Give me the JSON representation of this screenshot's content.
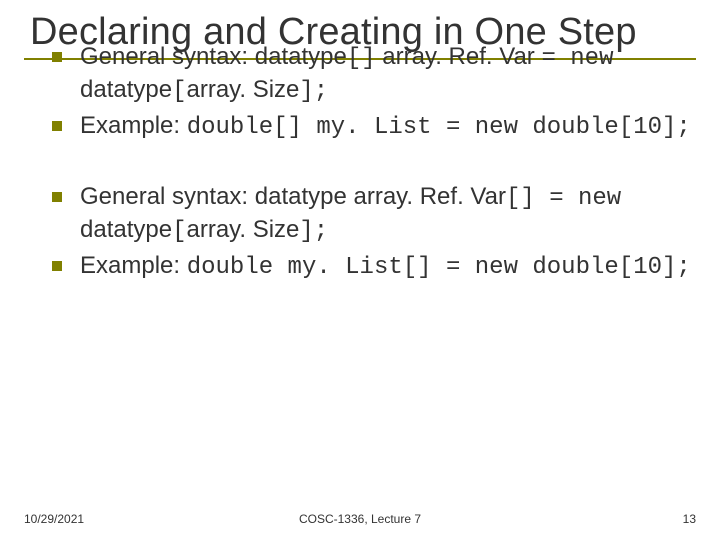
{
  "title": "Declaring and Creating in One Step",
  "bullets_group1": [
    {
      "pre": "General syntax: datatype",
      "mono1": "[]",
      "mid": "  array. Ref. Var ",
      "mono2": "= new",
      "line2a": "datatype",
      "line2mono": "[",
      "line2b": "array. Size",
      "line2mono2": "];"
    },
    {
      "pre": "Example: ",
      "code": "double[] my. List = new double[10];"
    }
  ],
  "bullets_group2": [
    {
      "pre": "General syntax:  datatype array. Ref. Var",
      "mono1": "[] = new",
      "line2a": "datatype",
      "line2mono": "[",
      "line2b": "array. Size",
      "line2mono2": "];"
    },
    {
      "pre": "Example: ",
      "code": "double my. List[] = new double[10];"
    }
  ],
  "footer": {
    "date": "10/29/2021",
    "course": "COSC-1336, Lecture 7",
    "page": "13"
  }
}
